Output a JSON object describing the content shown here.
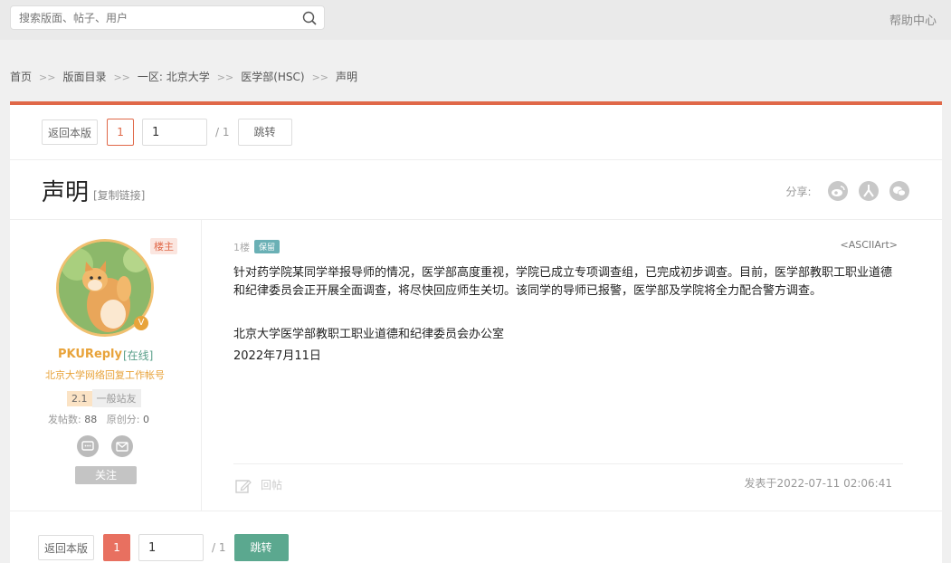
{
  "search": {
    "placeholder": "搜索版面、帖子、用户",
    "icon": "search-icon"
  },
  "header": {
    "help": "帮助中心"
  },
  "breadcrumb": {
    "items": [
      "首页",
      "版面目录",
      "一区: 北京大学",
      "医学部(HSC)",
      "声明"
    ],
    "separator": ">>"
  },
  "pager": {
    "back_label": "返回本版",
    "current_page": "1",
    "input_value": "1",
    "total": "/ 1",
    "jump_label": "跳转"
  },
  "post_header": {
    "title": "声明",
    "copy_link": "[复制链接]",
    "share_label": "分享:"
  },
  "author": {
    "badge": "楼主",
    "verified": "V",
    "name": "PKUReply",
    "status": "[在线]",
    "subtitle": "北京大学网络回复工作帐号",
    "level_num": "2.1",
    "level_title": "一般站友",
    "posts_label": "发帖数:",
    "posts": "88",
    "original_label": "原创分:",
    "original": "0",
    "follow": "关注"
  },
  "post": {
    "floor": "1楼",
    "tag": "保留",
    "ascii": "<ASCIIArt>",
    "paragraph1": "针对药学院某同学举报导师的情况，医学部高度重视，学院已成立专项调查组，已完成初步调查。目前，医学部教职工职业道德和纪律委员会正开展全面调查，将尽快回应师生关切。该同学的导师已报警，医学部及学院将全力配合警方调查。",
    "signature1": "北京大学医学部教职工职业道德和纪律委员会办公室",
    "signature2": "2022年7月11日",
    "reply_label": "回帖",
    "posted_at": "发表于2022-07-11 02:06:41"
  },
  "colors": {
    "accent": "#e06848",
    "teal": "#5ba88f",
    "gold": "#e8a33a"
  }
}
